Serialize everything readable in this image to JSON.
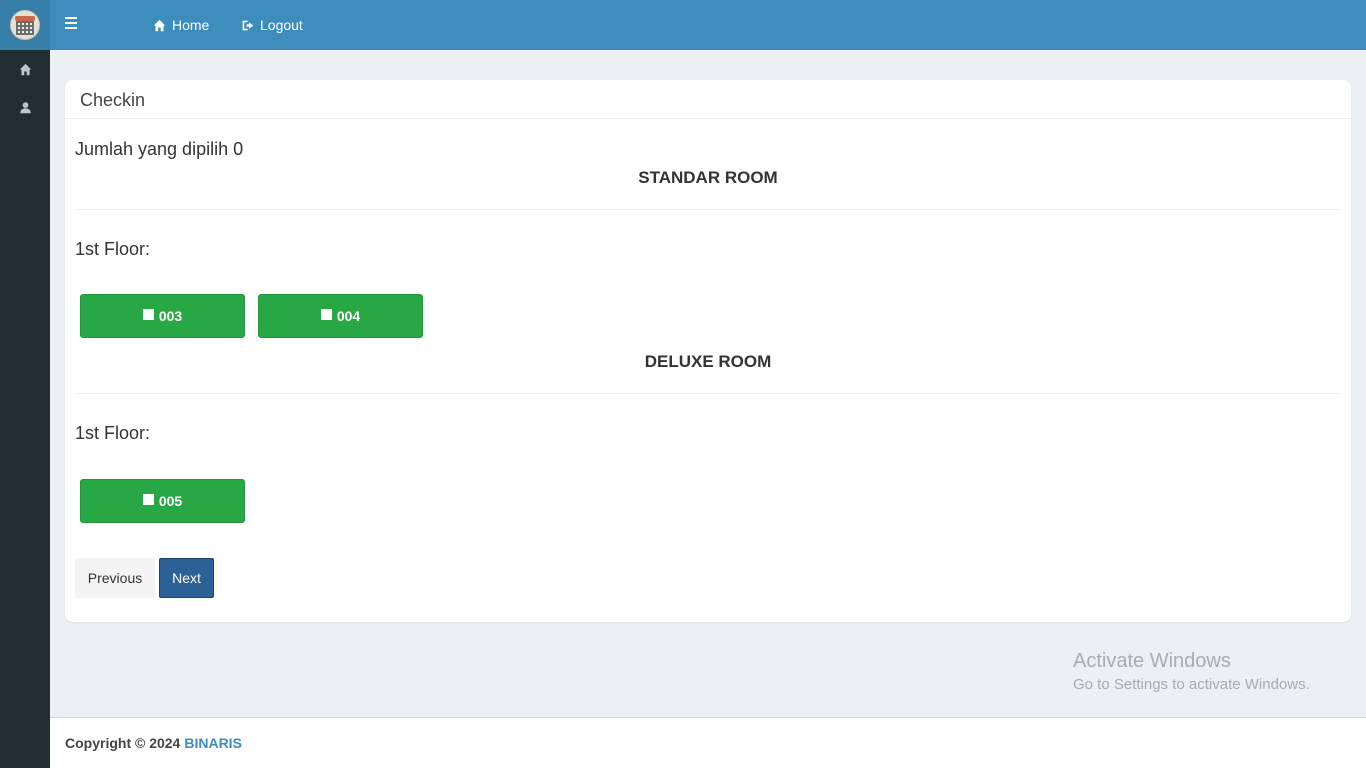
{
  "navbar": {
    "home_label": "Home",
    "logout_label": "Logout"
  },
  "sidebar": {
    "items": [
      {
        "icon": "home-icon"
      },
      {
        "icon": "user-icon"
      }
    ]
  },
  "box": {
    "title": "Checkin",
    "selected_count_text": "Jumlah yang dipilih 0",
    "sections": [
      {
        "title": "STANDAR ROOM",
        "floor_label": "1st Floor:",
        "rooms": [
          "003",
          "004"
        ]
      },
      {
        "title": "DELUXE ROOM",
        "floor_label": "1st Floor:",
        "rooms": [
          "005"
        ]
      }
    ],
    "previous_label": "Previous",
    "next_label": "Next"
  },
  "watermark": {
    "line1": "Activate Windows",
    "line2": "Go to Settings to activate Windows."
  },
  "footer": {
    "copyright": "Copyright © 2024",
    "brand": "BINARIS"
  },
  "colors": {
    "navbar": "#3c8dbc",
    "sidebar": "#222d32",
    "room_button": "#28a745",
    "next_button": "#2c6195"
  }
}
